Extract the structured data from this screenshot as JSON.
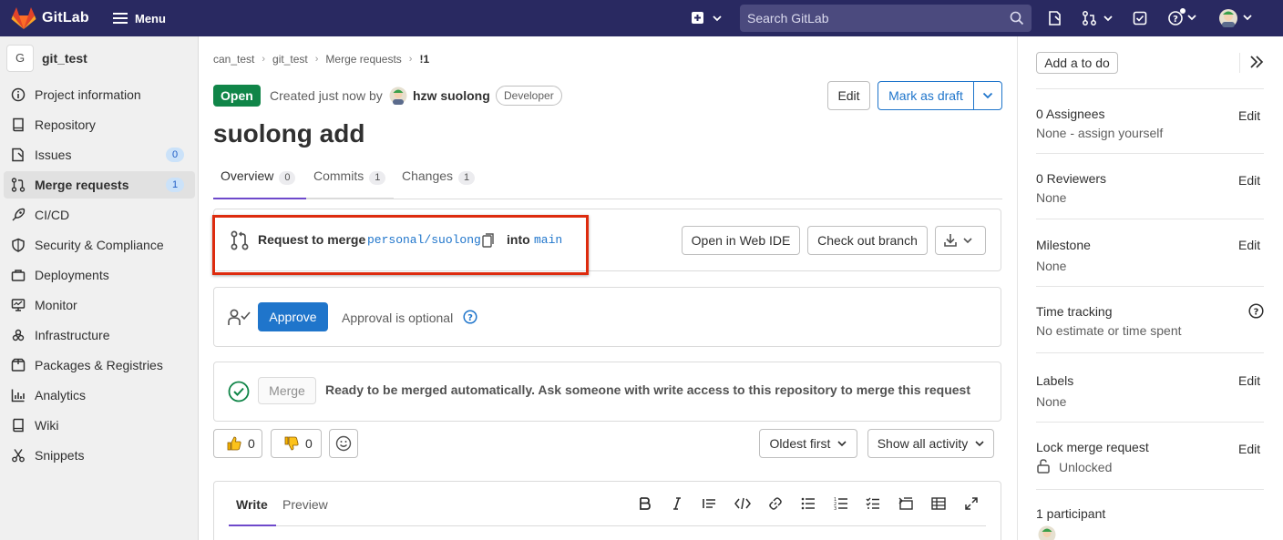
{
  "topbar": {
    "brand": "GitLab",
    "menu_label": "Menu",
    "search_placeholder": "Search GitLab"
  },
  "project": {
    "initial": "G",
    "name": "git_test"
  },
  "sidebar": {
    "items": [
      {
        "label": "Project information",
        "icon": "info-icon"
      },
      {
        "label": "Repository",
        "icon": "repository-icon"
      },
      {
        "label": "Issues",
        "icon": "issues-icon",
        "count": "0"
      },
      {
        "label": "Merge requests",
        "icon": "merge-request-icon",
        "count": "1",
        "active": true
      },
      {
        "label": "CI/CD",
        "icon": "rocket-icon"
      },
      {
        "label": "Security & Compliance",
        "icon": "shield-icon"
      },
      {
        "label": "Deployments",
        "icon": "deployments-icon"
      },
      {
        "label": "Monitor",
        "icon": "monitor-icon"
      },
      {
        "label": "Infrastructure",
        "icon": "cloud-icon"
      },
      {
        "label": "Packages & Registries",
        "icon": "package-icon"
      },
      {
        "label": "Analytics",
        "icon": "chart-icon"
      },
      {
        "label": "Wiki",
        "icon": "book-icon"
      },
      {
        "label": "Snippets",
        "icon": "scissors-icon"
      }
    ]
  },
  "breadcrumb": [
    "can_test",
    "git_test",
    "Merge requests",
    "!1"
  ],
  "mr": {
    "status": "Open",
    "created_text": "Created just now by",
    "author": "hzw suolong",
    "role": "Developer",
    "title": "suolong add",
    "edit_label": "Edit",
    "draft_label": "Mark as draft"
  },
  "tabs": [
    {
      "label": "Overview",
      "count": "0",
      "active": true
    },
    {
      "label": "Commits",
      "count": "1"
    },
    {
      "label": "Changes",
      "count": "1"
    }
  ],
  "merge_info": {
    "prefix": "Request to merge",
    "source_branch": "personal/suolong",
    "into": "into",
    "target_branch": "main",
    "web_ide_label": "Open in Web IDE",
    "checkout_label": "Check out branch"
  },
  "approval": {
    "button": "Approve",
    "note": "Approval is optional"
  },
  "merge_widget": {
    "button": "Merge",
    "message": "Ready to be merged automatically. Ask someone with write access to this repository to merge this request"
  },
  "reactions": {
    "thumbs_up": "0",
    "thumbs_down": "0"
  },
  "activity": {
    "sort_label": "Oldest first",
    "filter_label": "Show all activity"
  },
  "editor": {
    "write_tab": "Write",
    "preview_tab": "Preview"
  },
  "rightbar": {
    "todo_label": "Add a to do",
    "edit_label": "Edit",
    "assignees_title": "0 Assignees",
    "assignees_value": "None - assign yourself",
    "reviewers_title": "0 Reviewers",
    "reviewers_value": "None",
    "milestone_title": "Milestone",
    "milestone_value": "None",
    "time_title": "Time tracking",
    "time_value": "No estimate or time spent",
    "labels_title": "Labels",
    "labels_value": "None",
    "lock_title": "Lock merge request",
    "lock_value": "Unlocked",
    "participants_title": "1 participant"
  },
  "colors": {
    "topbar": "#292961",
    "link": "#1f75cb",
    "success": "#108548",
    "highlight_border": "#dd2b0e"
  }
}
